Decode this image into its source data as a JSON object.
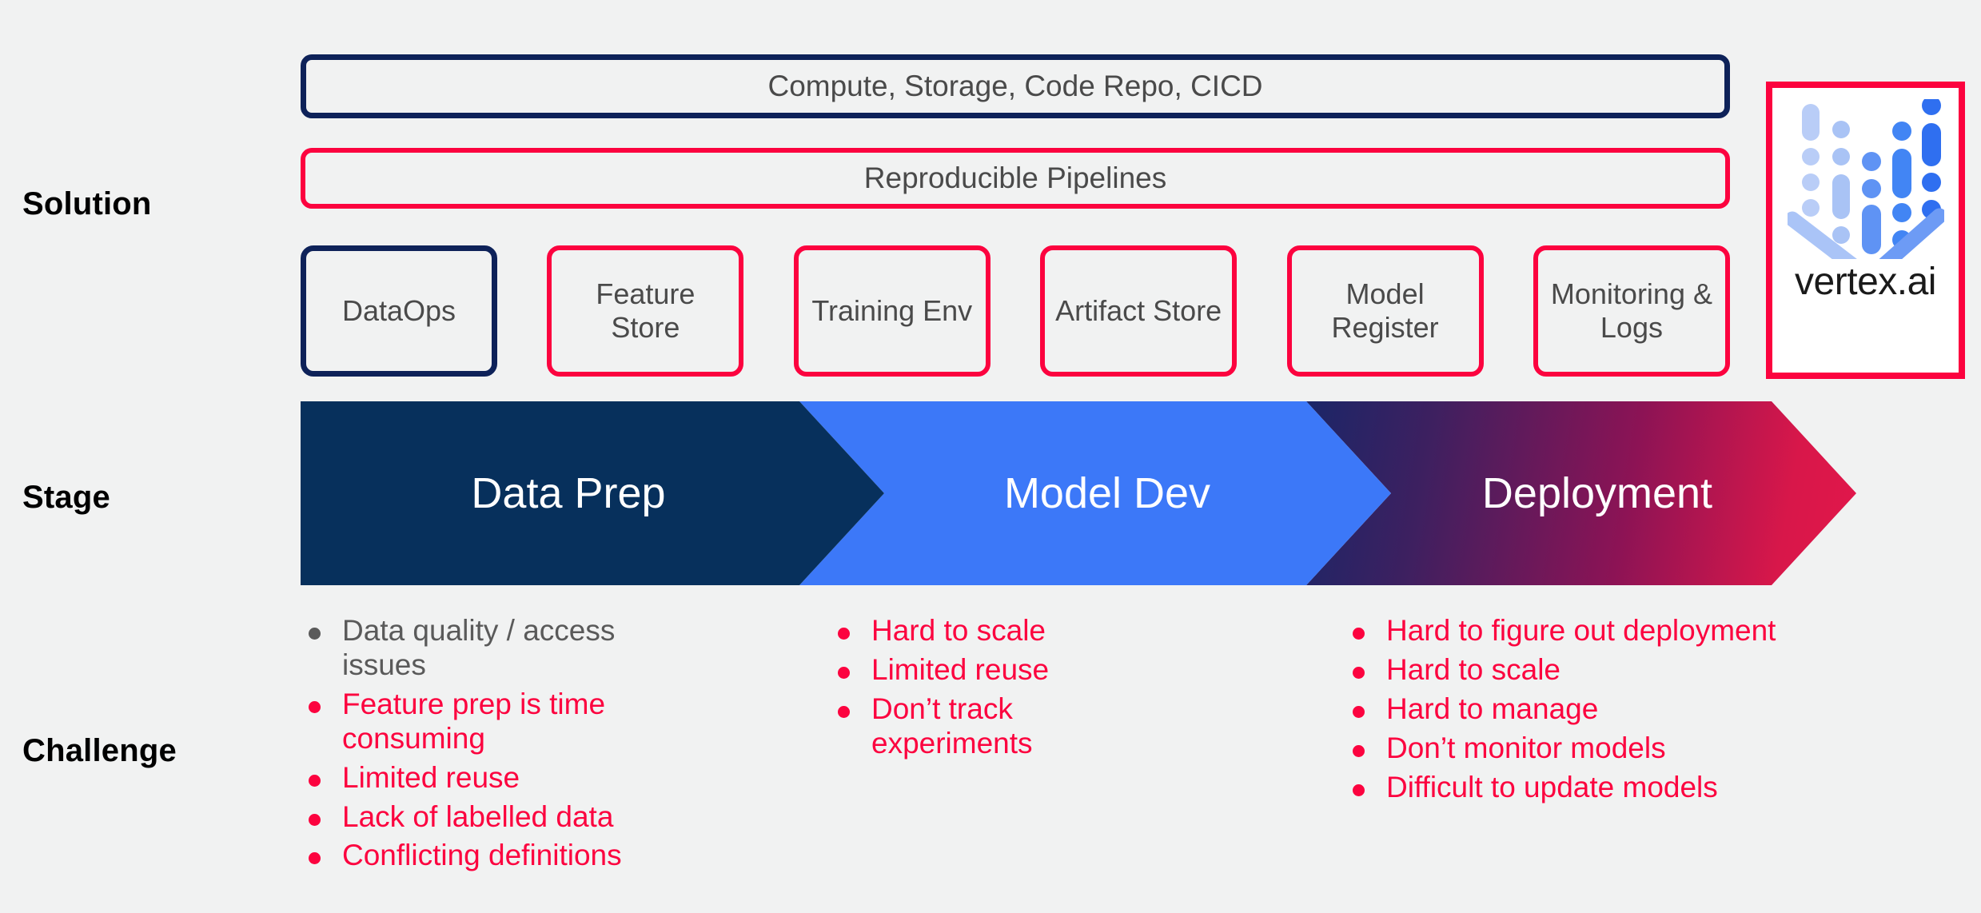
{
  "rows": {
    "solution_label": "Solution",
    "stage_label": "Stage",
    "challenge_label": "Challenge"
  },
  "solution": {
    "banners": [
      {
        "label": "Compute, Storage, Code Repo, CICD",
        "color": "#0e2259"
      },
      {
        "label": "Reproducible Pipelines",
        "color": "#fc033f"
      }
    ],
    "tiles": [
      {
        "label": "DataOps",
        "color": "#0e2259"
      },
      {
        "label": "Feature Store",
        "color": "#fc033f"
      },
      {
        "label": "Training Env",
        "color": "#fc033f"
      },
      {
        "label": "Artifact Store",
        "color": "#fc033f"
      },
      {
        "label": "Model Register",
        "color": "#fc033f"
      },
      {
        "label": "Monitoring & Logs",
        "color": "#fc033f"
      }
    ]
  },
  "vertex": {
    "wordmark": "vertex.ai",
    "border_color": "#fc033f"
  },
  "stages": [
    {
      "label": "Data Prep",
      "color": "#07305c"
    },
    {
      "label": "Model Dev",
      "color": "#3c78f8"
    },
    {
      "label": "Deployment",
      "color": "#d8174a"
    }
  ],
  "challenges": [
    {
      "stage": "Data Prep",
      "items": [
        {
          "text": "Data quality / access issues",
          "color": "#5a5a5a"
        },
        {
          "text": "Feature prep is time consuming",
          "color": "#fc033f"
        },
        {
          "text": "Limited reuse",
          "color": "#fc033f"
        },
        {
          "text": "Lack of labelled data",
          "color": "#fc033f"
        },
        {
          "text": "Conflicting definitions",
          "color": "#fc033f"
        }
      ]
    },
    {
      "stage": "Model Dev",
      "items": [
        {
          "text": "Hard to scale",
          "color": "#fc033f"
        },
        {
          "text": "Limited reuse",
          "color": "#fc033f"
        },
        {
          "text": "Don’t track experiments",
          "color": "#fc033f"
        }
      ]
    },
    {
      "stage": "Deployment",
      "items": [
        {
          "text": "Hard to figure out deployment",
          "color": "#fc033f"
        },
        {
          "text": "Hard to scale",
          "color": "#fc033f"
        },
        {
          "text": "Hard to manage",
          "color": "#fc033f"
        },
        {
          "text": "Don’t monitor models",
          "color": "#fc033f"
        },
        {
          "text": "Difficult to update models",
          "color": "#fc033f"
        }
      ]
    }
  ]
}
